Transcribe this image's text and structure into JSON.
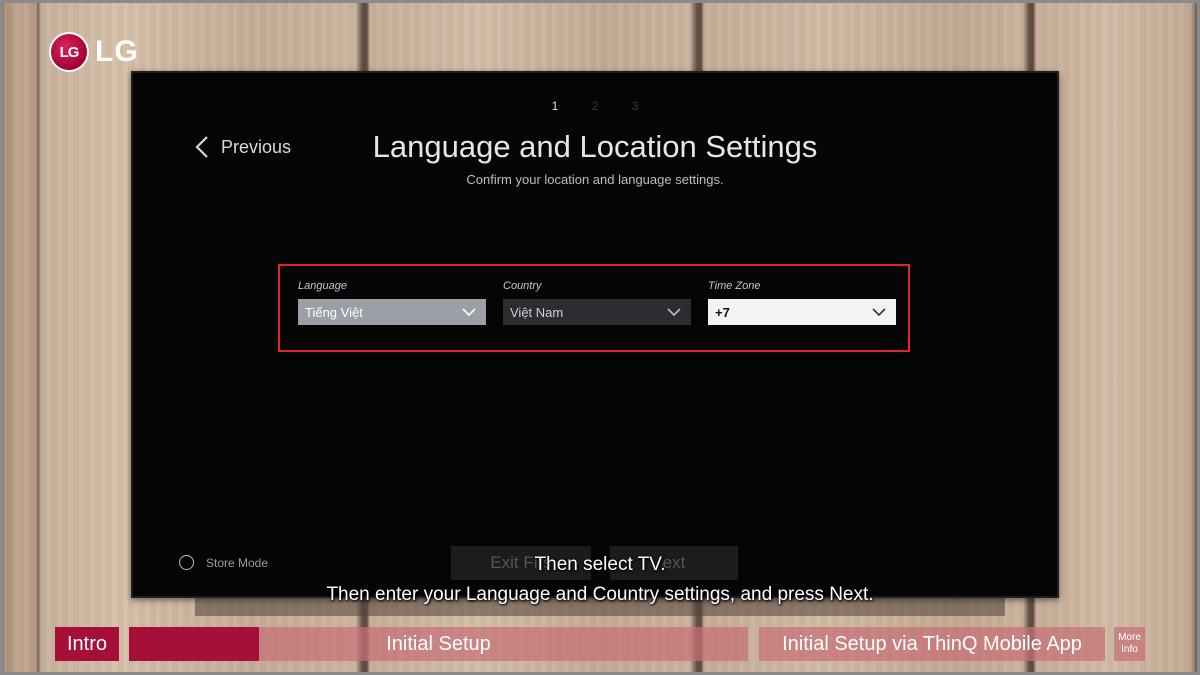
{
  "brand": {
    "logo_mark": "LG",
    "logo_text": "LG",
    "color": "#a50034"
  },
  "tv_screen": {
    "steps": [
      "1",
      "2",
      "3"
    ],
    "active_step": "1",
    "previous_label": "Previous",
    "title": "Language and Location Settings",
    "subtitle": "Confirm your location and language settings.",
    "settings": {
      "highlight_color": "#e0262d",
      "language": {
        "label": "Language",
        "value": "Tiếng Việt"
      },
      "country": {
        "label": "Country",
        "value": "Việt Nam"
      },
      "time_zone": {
        "label": "Time Zone",
        "value": "+7"
      }
    },
    "store_mode_label": "Store Mode",
    "exit_button_label": "Exit Firs",
    "next_button_label": "ext"
  },
  "captions": {
    "line1": "Then select TV.",
    "line2": "Then enter your Language and Country settings, and press Next."
  },
  "bottom_nav": {
    "intro": "Intro",
    "initial_setup": "Initial Setup",
    "initial_setup_progress": 0.21,
    "thinq": "Initial Setup via ThinQ Mobile App",
    "more_info": "More Info"
  }
}
